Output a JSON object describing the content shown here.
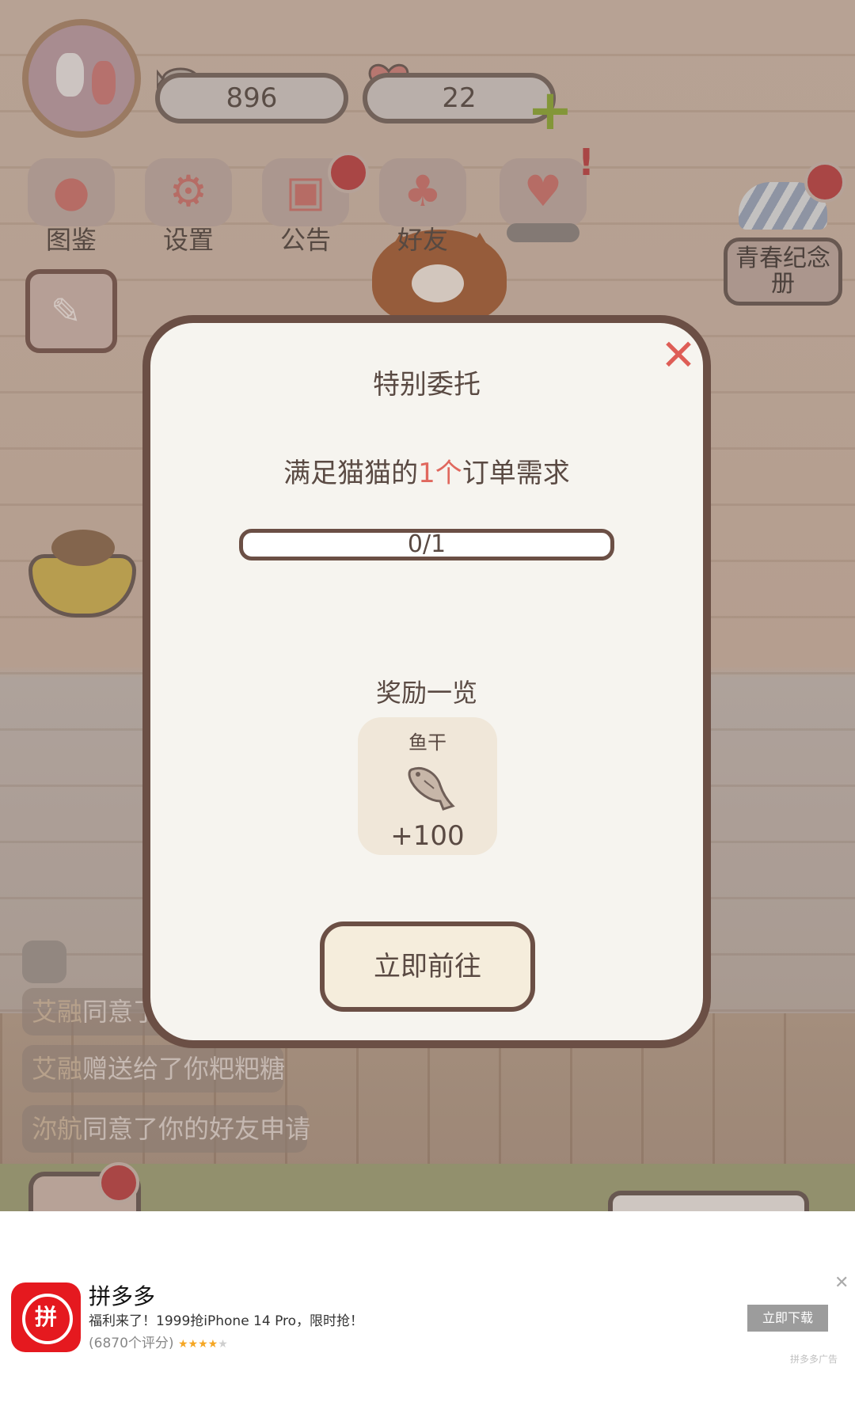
{
  "hud": {
    "fish_count": "896",
    "heart_count": "22"
  },
  "menu": [
    {
      "label": "图鉴",
      "icon": "cat-book-icon"
    },
    {
      "label": "设置",
      "icon": "gear-icon"
    },
    {
      "label": "公告",
      "icon": "gift-icon"
    },
    {
      "label": "好友",
      "icon": "friends-icon"
    },
    {
      "label": "",
      "icon": "hearts-icon"
    }
  ],
  "youth_book": {
    "label": "青春纪念册"
  },
  "chat": [
    {
      "name": "艾融",
      "text": "同意了"
    },
    {
      "name": "艾融",
      "text": "赠送给了你粑粑糖"
    },
    {
      "name": "沵航",
      "text": "同意了你的好友申请"
    }
  ],
  "dialog": {
    "title": "特别委托",
    "task_prefix": "满足猫猫的",
    "task_highlight": "1个",
    "task_suffix": "订单需求",
    "progress_text": "0/1",
    "progress_value": 0,
    "reward_title": "奖励一览",
    "reward": {
      "name": "鱼干",
      "amount": "+100",
      "icon": "dried-fish-icon"
    },
    "go_button": "立即前往"
  },
  "ad": {
    "logo_text": "拼",
    "app_name": "拼多多",
    "text": "福利来了！1999抢iPhone 14 Pro，限时抢！",
    "rating": "(6870个评分)",
    "stars": 4,
    "download_button": "立即下载",
    "tag": "拼多多广告",
    "close": "✕"
  },
  "colors": {
    "dialog_border": "#6b4f45",
    "highlight": "#e0685e",
    "close": "#de5d56",
    "ad_logo": "#e5191f"
  }
}
